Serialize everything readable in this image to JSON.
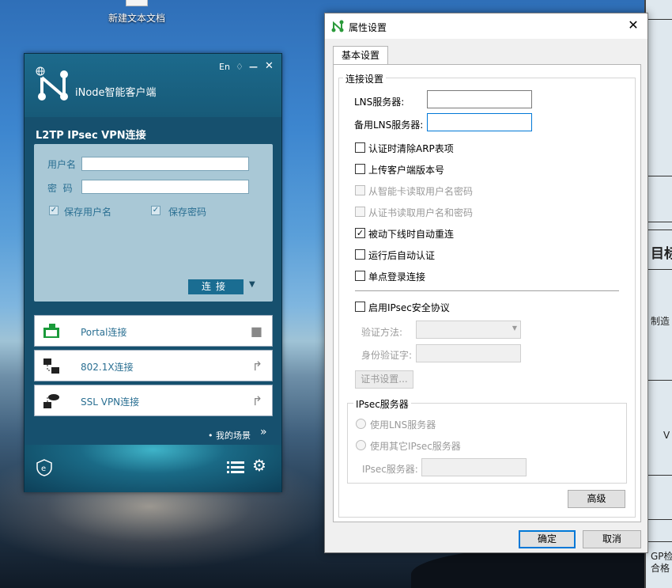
{
  "desktop": {
    "icon_label": "新建文本文档"
  },
  "background_doc": {
    "texts": [
      "目标",
      "制造",
      "V",
      "GP检",
      "合格"
    ]
  },
  "inode": {
    "title": "iNode智能客户端",
    "lang": "En",
    "vpn_title": "L2TP IPsec VPN连接",
    "username_label": "用户名",
    "password_label": "密  码",
    "save_user_label": "保存用户名",
    "save_pass_label": "保存密码",
    "connect_label": "连接",
    "connections": [
      {
        "label": "Portal连接",
        "icon": "portal-icon"
      },
      {
        "label": "802.1X连接",
        "icon": "network-icon"
      },
      {
        "label": "SSL VPN连接",
        "icon": "cloud-network-icon"
      }
    ],
    "scene_label": "• 我的场景",
    "accent": "#1a6d92"
  },
  "dialog": {
    "title": "属性设置",
    "tab": "基本设置",
    "conn_group": "连接设置",
    "lns_label": "LNS服务器:",
    "backup_lns_label": "备用LNS服务器:",
    "options": [
      {
        "label": "认证时清除ARP表项",
        "checked": false,
        "disabled": false
      },
      {
        "label": "上传客户端版本号",
        "checked": false,
        "disabled": false
      },
      {
        "label": "从智能卡读取用户名密码",
        "checked": false,
        "disabled": true
      },
      {
        "label": "从证书读取用户名和密码",
        "checked": false,
        "disabled": true
      },
      {
        "label": "被动下线时自动重连",
        "checked": true,
        "disabled": false
      },
      {
        "label": "运行后自动认证",
        "checked": false,
        "disabled": false
      },
      {
        "label": "单点登录连接",
        "checked": false,
        "disabled": false
      }
    ],
    "ipsec_enable": "启用IPsec安全协议",
    "auth_method_label": "验证方法:",
    "auth_word_label": "身份验证字:",
    "cert_button": "证书设置...",
    "ipsec_group": "IPsec服务器",
    "use_lns": "使用LNS服务器",
    "use_other": "使用其它IPsec服务器",
    "ipsec_server_label": "IPsec服务器:",
    "advanced_button": "高级",
    "ok_button": "确定",
    "cancel_button": "取消"
  }
}
